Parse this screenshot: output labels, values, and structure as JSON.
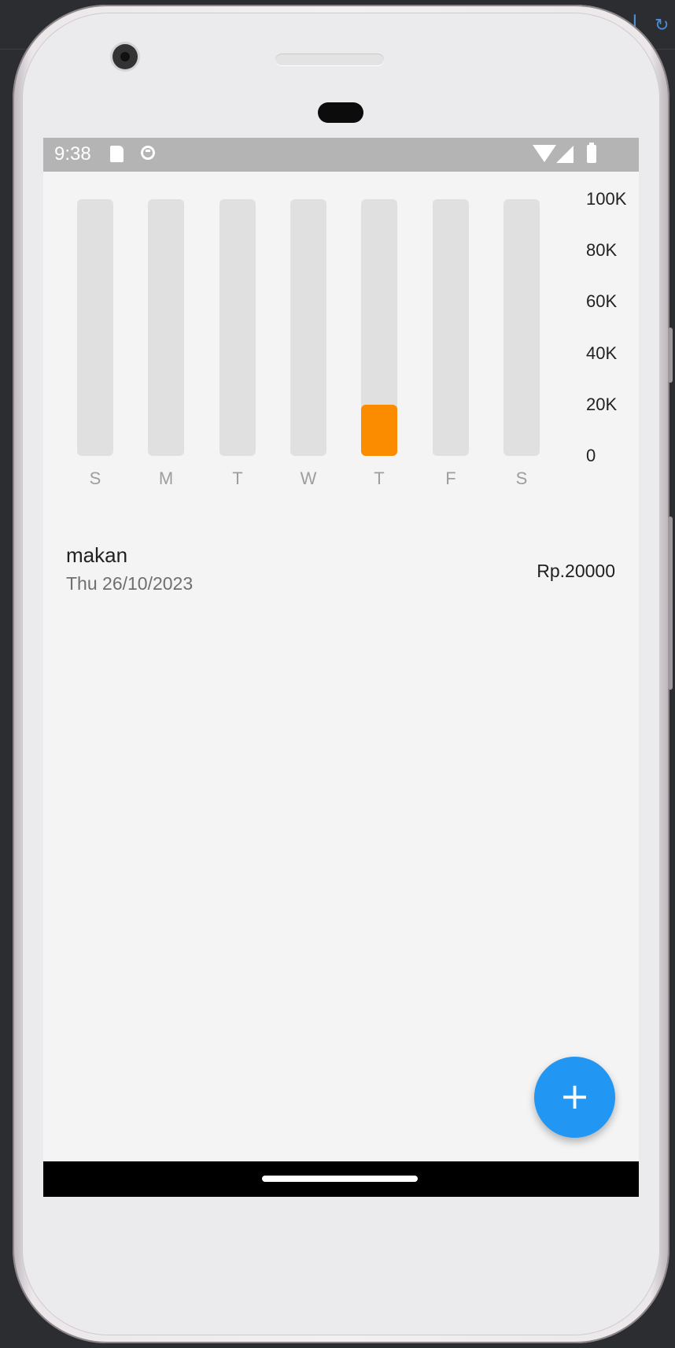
{
  "status_bar": {
    "time": "9:38",
    "icons": [
      "sd-card-icon",
      "notification-circle-icon",
      "wifi-icon",
      "cell-signal-icon",
      "battery-icon"
    ]
  },
  "chart_data": {
    "type": "bar",
    "categories": [
      "S",
      "M",
      "T",
      "W",
      "T",
      "F",
      "S"
    ],
    "values": [
      0,
      0,
      0,
      0,
      20000,
      0,
      0
    ],
    "ylim": [
      0,
      100000
    ],
    "ytick_labels": [
      "100K",
      "80K",
      "60K",
      "40K",
      "20K",
      "0"
    ],
    "bar_color": "#fb8c00",
    "track_color": "#e0e0e0",
    "grid": false,
    "legend": "none"
  },
  "transactions": [
    {
      "title": "makan",
      "date": "Thu 26/10/2023",
      "amount": "Rp.20000"
    }
  ],
  "fab": {
    "label": "+",
    "icon": "plus-icon",
    "color": "#2196f3"
  }
}
